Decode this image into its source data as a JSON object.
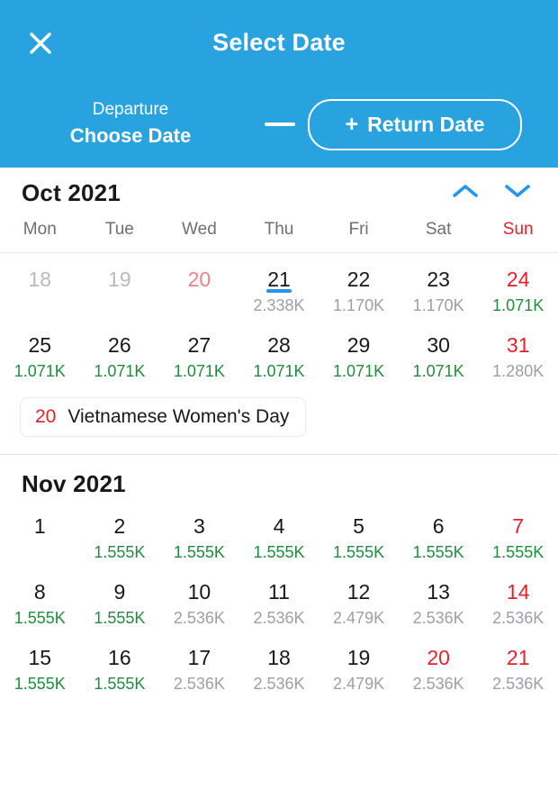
{
  "header": {
    "title": "Select Date",
    "close_icon": "close-icon",
    "departure_label": "Departure",
    "departure_value": "Choose Date",
    "separator": "dash-separator",
    "return_button": {
      "plus": "+",
      "label": "Return Date"
    }
  },
  "weekdays": [
    {
      "label": "Mon",
      "weekend": false
    },
    {
      "label": "Tue",
      "weekend": false
    },
    {
      "label": "Wed",
      "weekend": false
    },
    {
      "label": "Thu",
      "weekend": false
    },
    {
      "label": "Fri",
      "weekend": false
    },
    {
      "label": "Sat",
      "weekend": false
    },
    {
      "label": "Sun",
      "weekend": true
    }
  ],
  "colors": {
    "brand_blue": "#29A3E0",
    "accent_blue": "#2196F3",
    "red": "#e8202a",
    "faded_red": "#ef8289",
    "green": "#1e8e3e",
    "gray_price": "#9aa0a6",
    "gray_disabled": "#b7bbbf"
  },
  "months": [
    {
      "title": "Oct 2021",
      "nav": {
        "up_icon": "chevron-up-icon",
        "down_icon": "chevron-down-icon"
      },
      "show_weekdays": true,
      "weeks": [
        [
          {
            "day": "18",
            "price": "",
            "state": "disabled",
            "price_style": "empty"
          },
          {
            "day": "19",
            "price": "",
            "state": "disabled",
            "price_style": "empty"
          },
          {
            "day": "20",
            "price": "",
            "state": "disabled-red",
            "price_style": "empty"
          },
          {
            "day": "21",
            "price": "2.338K",
            "state": "today",
            "price_style": "gray"
          },
          {
            "day": "22",
            "price": "1.170K",
            "state": "normal",
            "price_style": "gray"
          },
          {
            "day": "23",
            "price": "1.170K",
            "state": "normal",
            "price_style": "gray"
          },
          {
            "day": "24",
            "price": "1.071K",
            "state": "red",
            "price_style": "green"
          }
        ],
        [
          {
            "day": "25",
            "price": "1.071K",
            "state": "normal",
            "price_style": "green"
          },
          {
            "day": "26",
            "price": "1.071K",
            "state": "normal",
            "price_style": "green"
          },
          {
            "day": "27",
            "price": "1.071K",
            "state": "normal",
            "price_style": "green"
          },
          {
            "day": "28",
            "price": "1.071K",
            "state": "normal",
            "price_style": "green"
          },
          {
            "day": "29",
            "price": "1.071K",
            "state": "normal",
            "price_style": "green"
          },
          {
            "day": "30",
            "price": "1.071K",
            "state": "normal",
            "price_style": "green"
          },
          {
            "day": "31",
            "price": "1.280K",
            "state": "red",
            "price_style": "gray"
          }
        ]
      ],
      "holidays": [
        {
          "day": "20",
          "name": "Vietnamese Women's Day"
        }
      ]
    },
    {
      "title": "Nov 2021",
      "nav": {
        "up_icon": "chevron-up-icon",
        "down_icon": "chevron-down-icon"
      },
      "show_weekdays": false,
      "weeks": [
        [
          {
            "day": "1",
            "price": "",
            "state": "normal",
            "price_style": "empty"
          },
          {
            "day": "2",
            "price": "1.555K",
            "state": "normal",
            "price_style": "green"
          },
          {
            "day": "3",
            "price": "1.555K",
            "state": "normal",
            "price_style": "green"
          },
          {
            "day": "4",
            "price": "1.555K",
            "state": "normal",
            "price_style": "green"
          },
          {
            "day": "5",
            "price": "1.555K",
            "state": "normal",
            "price_style": "green"
          },
          {
            "day": "6",
            "price": "1.555K",
            "state": "normal",
            "price_style": "green"
          },
          {
            "day": "7",
            "price": "1.555K",
            "state": "red",
            "price_style": "green"
          }
        ],
        [
          {
            "day": "8",
            "price": "1.555K",
            "state": "normal",
            "price_style": "green"
          },
          {
            "day": "9",
            "price": "1.555K",
            "state": "normal",
            "price_style": "green"
          },
          {
            "day": "10",
            "price": "2.536K",
            "state": "normal",
            "price_style": "gray"
          },
          {
            "day": "11",
            "price": "2.536K",
            "state": "normal",
            "price_style": "gray"
          },
          {
            "day": "12",
            "price": "2.479K",
            "state": "normal",
            "price_style": "gray"
          },
          {
            "day": "13",
            "price": "2.536K",
            "state": "normal",
            "price_style": "gray"
          },
          {
            "day": "14",
            "price": "2.536K",
            "state": "red",
            "price_style": "gray"
          }
        ],
        [
          {
            "day": "15",
            "price": "1.555K",
            "state": "normal",
            "price_style": "green"
          },
          {
            "day": "16",
            "price": "1.555K",
            "state": "normal",
            "price_style": "green"
          },
          {
            "day": "17",
            "price": "2.536K",
            "state": "normal",
            "price_style": "gray"
          },
          {
            "day": "18",
            "price": "2.536K",
            "state": "normal",
            "price_style": "gray"
          },
          {
            "day": "19",
            "price": "2.479K",
            "state": "normal",
            "price_style": "gray"
          },
          {
            "day": "20",
            "price": "2.536K",
            "state": "red",
            "price_style": "gray"
          },
          {
            "day": "21",
            "price": "2.536K",
            "state": "red",
            "price_style": "gray"
          }
        ]
      ],
      "holidays": []
    }
  ]
}
